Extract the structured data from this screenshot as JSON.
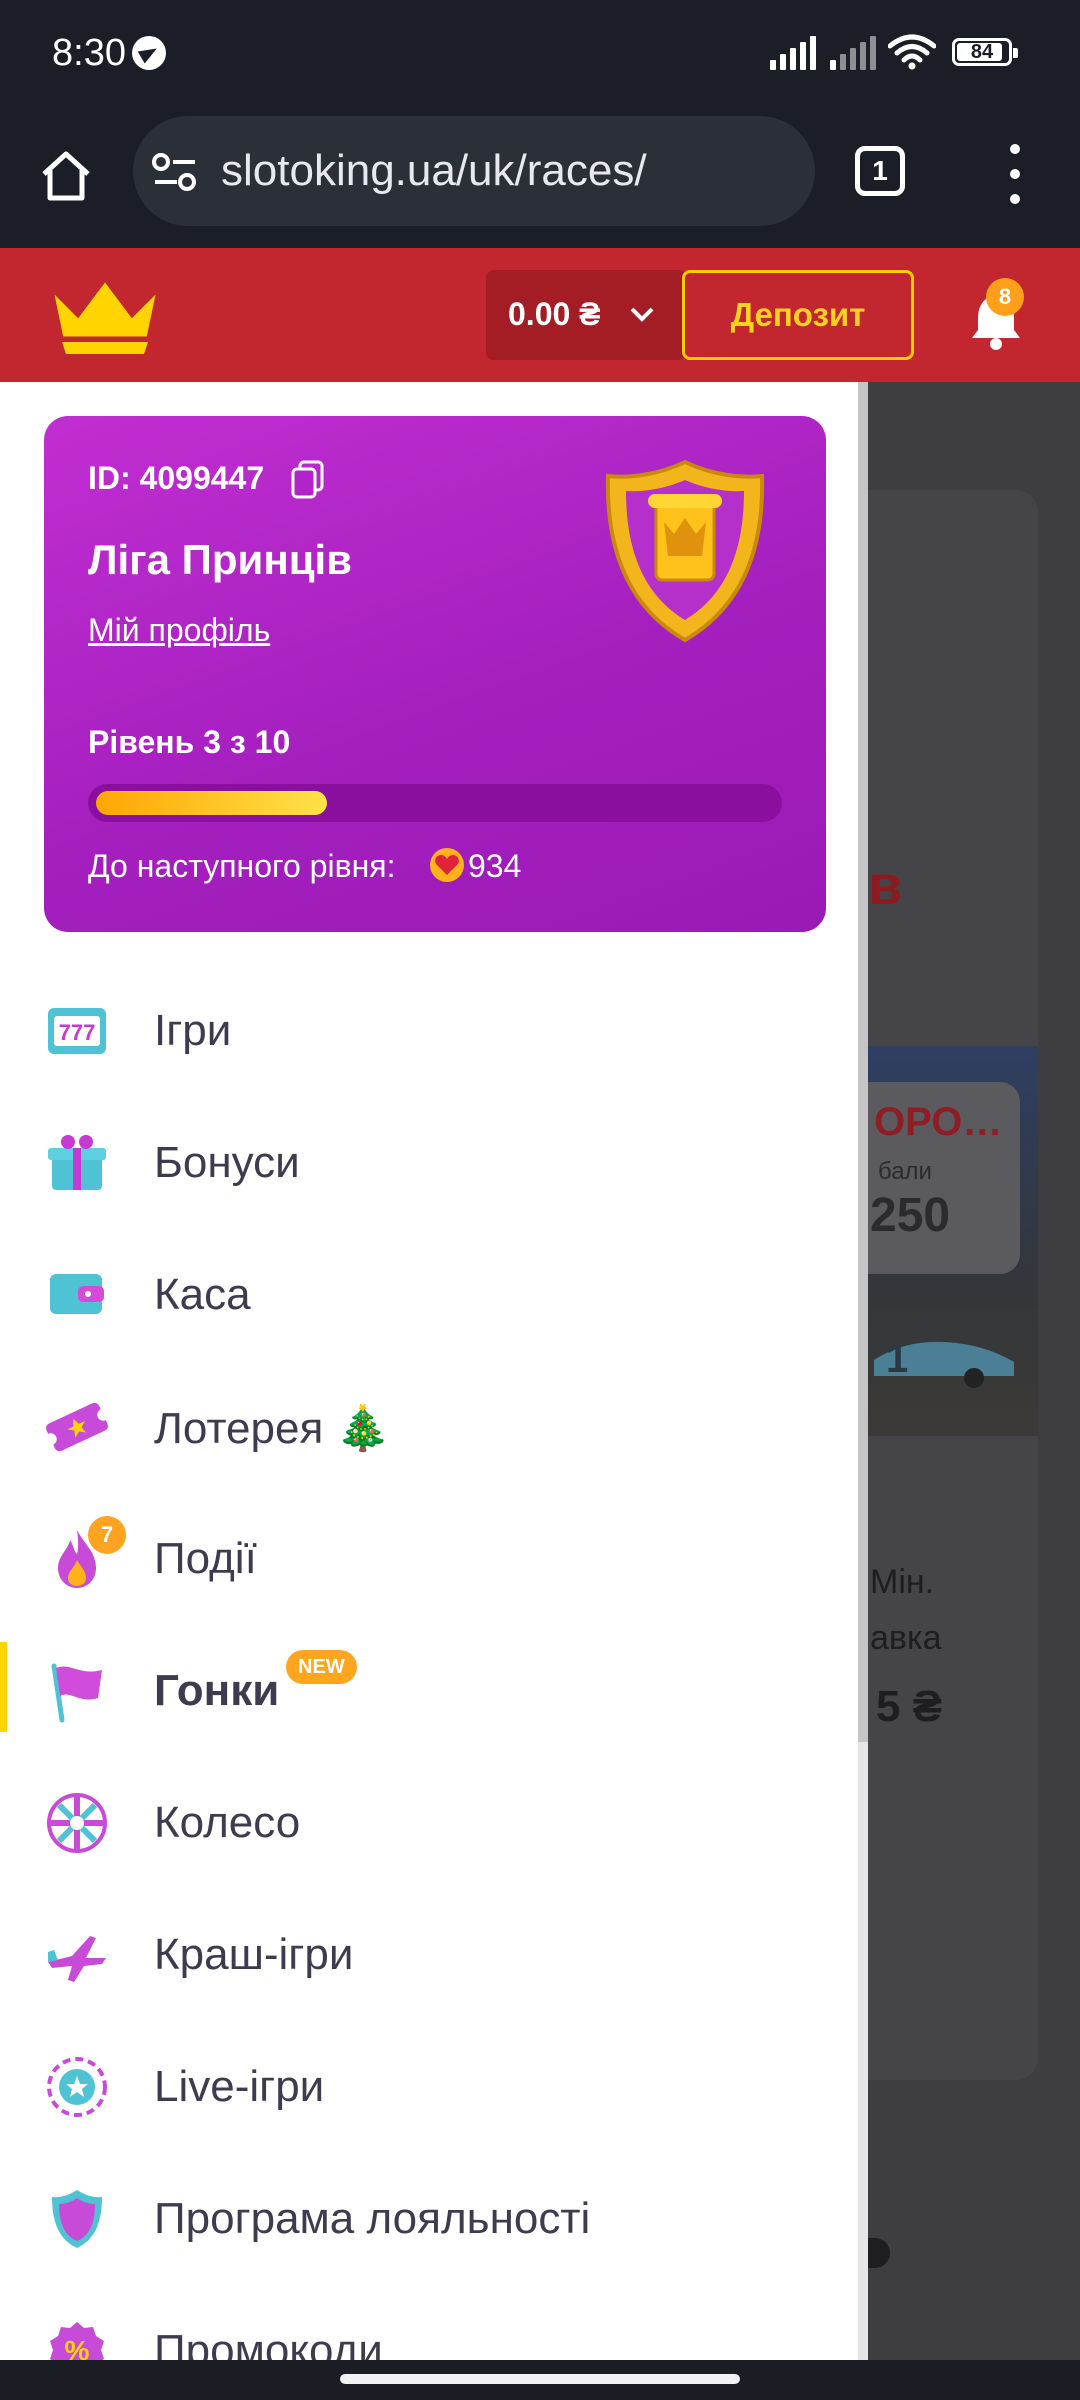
{
  "status_bar": {
    "time": "8:30",
    "battery": "84",
    "battery_level": 0.84
  },
  "browser": {
    "url": "slotoking.ua/uk/races/",
    "tab_count": "1"
  },
  "header": {
    "balance": "0.00 ₴",
    "deposit_label": "Депозит",
    "notifications_count": "8"
  },
  "profile": {
    "id_text": "ID: 4099447",
    "league": "Ліга Принців",
    "profile_link": "Мій профіль",
    "level_text": "Рівень 3 з 10",
    "level_progress": 0.34,
    "next_level_label": "До наступного рівня:",
    "next_level_points": "934"
  },
  "menu": [
    {
      "label": "Ігри",
      "icon": "slot-777-icon"
    },
    {
      "label": "Бонуси",
      "icon": "gift-icon"
    },
    {
      "label": "Каса",
      "icon": "wallet-icon"
    },
    {
      "label": "Лотерея 🎄",
      "icon": "ticket-icon"
    },
    {
      "label": "Події",
      "icon": "fire-icon",
      "badge": "7"
    },
    {
      "label": "Гонки",
      "icon": "flag-icon",
      "badge_new": "NEW",
      "active": true
    },
    {
      "label": "Колесо",
      "icon": "wheel-icon"
    },
    {
      "label": "Краш-ігри",
      "icon": "plane-icon"
    },
    {
      "label": "Live-ігри",
      "icon": "live-chip-icon"
    },
    {
      "label": "Програма лояльності",
      "icon": "loyalty-shield-icon"
    },
    {
      "label": "Промокоди",
      "icon": "percent-icon"
    }
  ],
  "background_page": {
    "tip_title": "ОРО…",
    "tip_sub": "бали",
    "tip_value": "250",
    "partial_red": "в",
    "min_line1": "Мін.",
    "min_line2": "авка",
    "min_value": "5 ₴",
    "car_number": "1"
  },
  "colors": {
    "header_red": "#c2262f",
    "card_purple": "#b024c8",
    "deposit_yellow": "#ffd21f",
    "active_marker": "#ffd400"
  }
}
